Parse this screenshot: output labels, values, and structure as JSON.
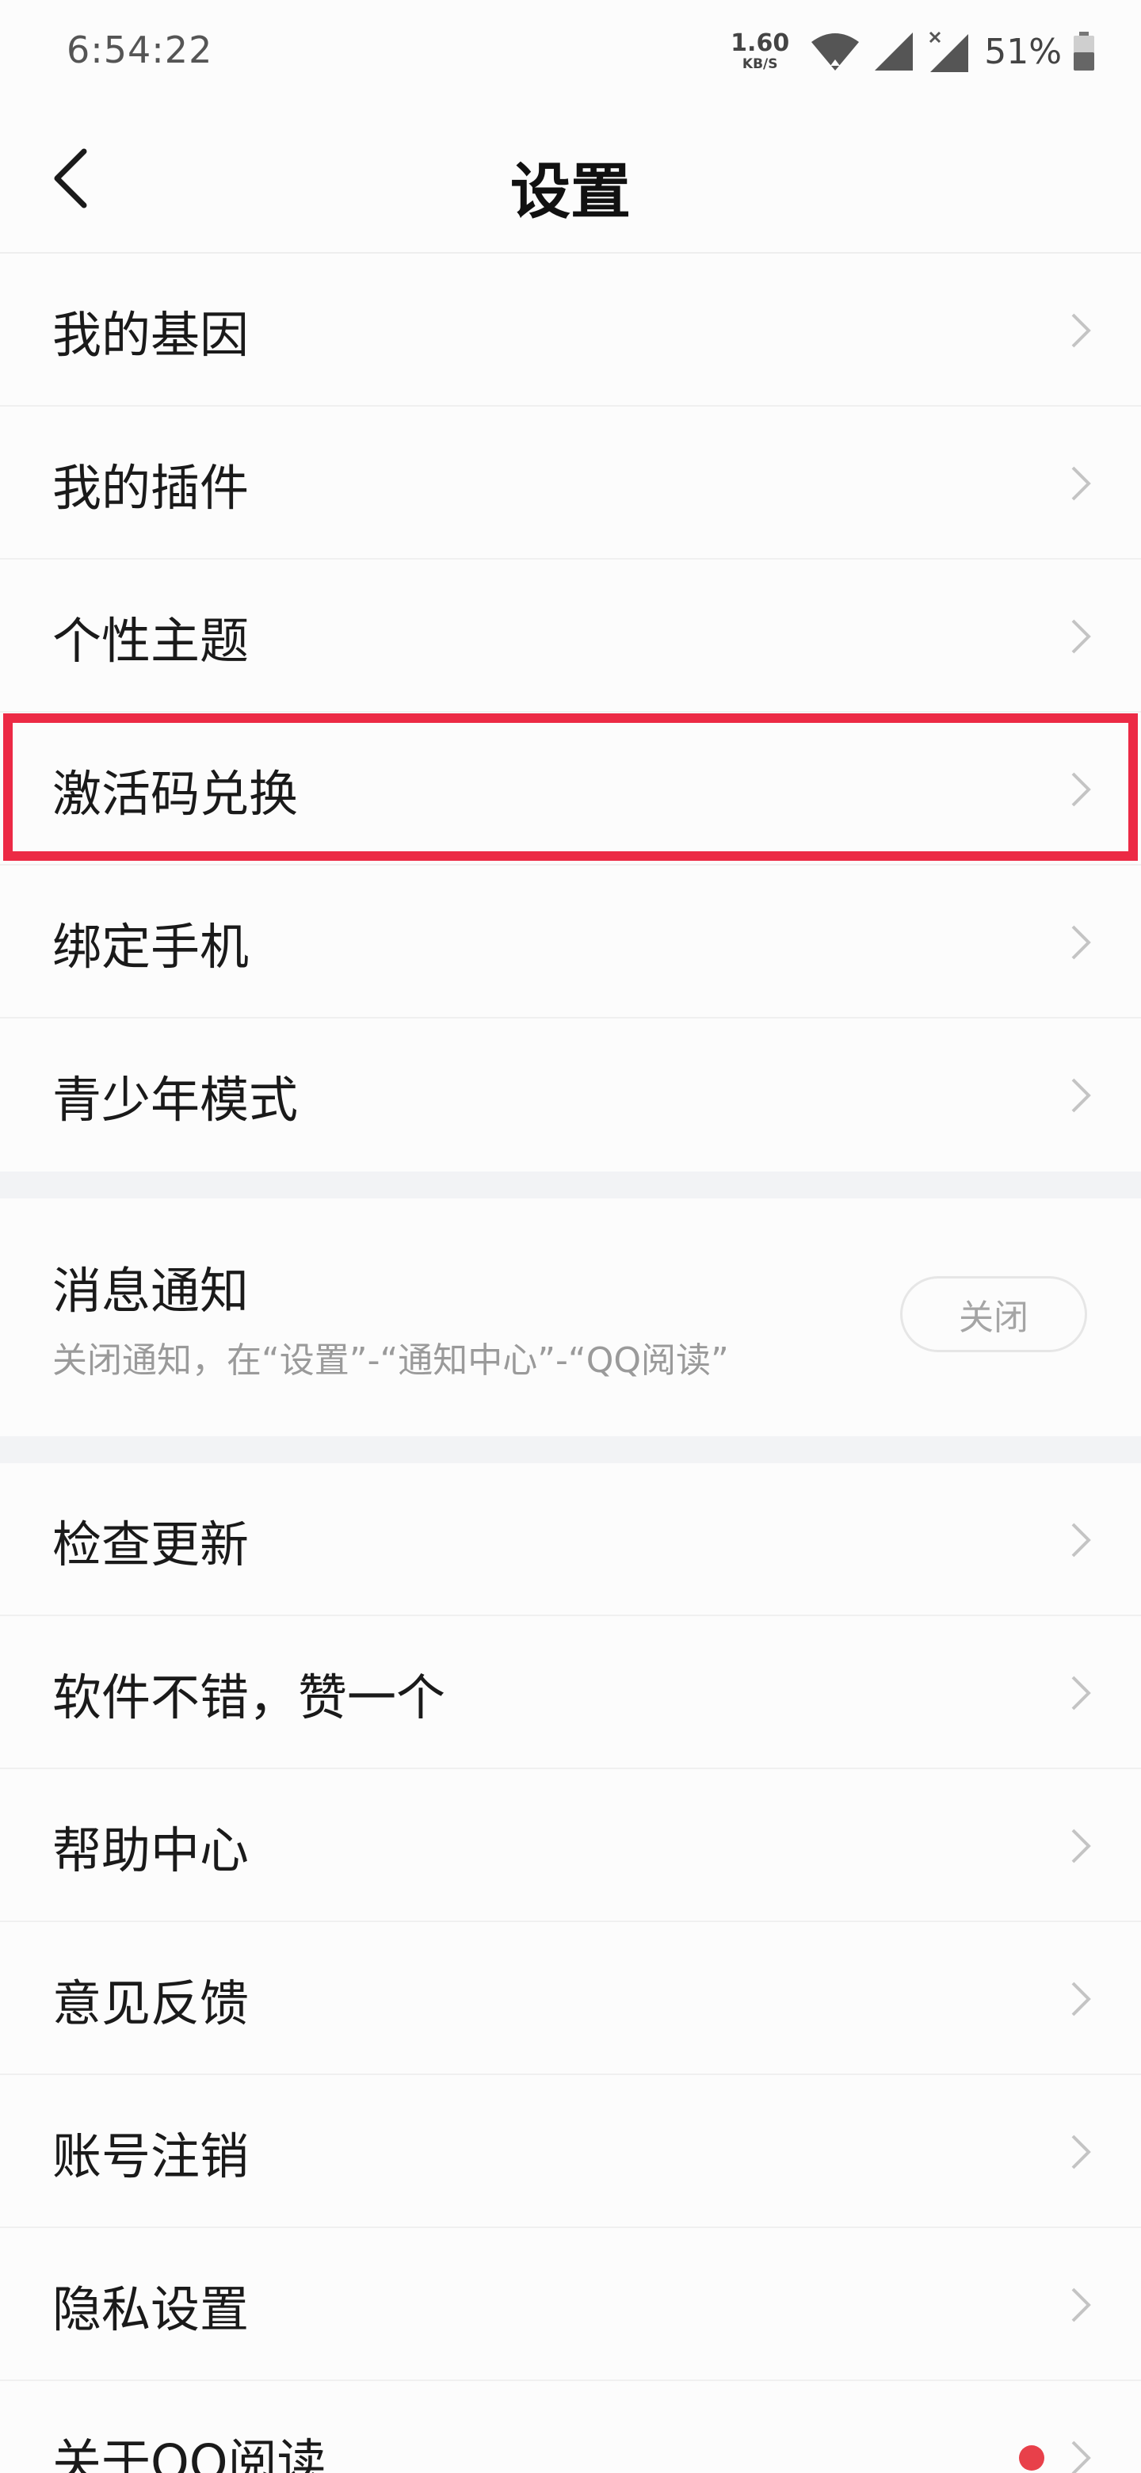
{
  "status_bar": {
    "time": "6:54:22",
    "net_speed_value": "1.60",
    "net_speed_unit": "KB/S",
    "battery_percent": "51%",
    "icons": [
      "wifi-icon",
      "signal-icon",
      "signal-x-icon",
      "battery-icon"
    ]
  },
  "header": {
    "title": "设置",
    "back_icon": "back-arrow-icon"
  },
  "group1": [
    {
      "label": "我的基因"
    },
    {
      "label": "我的插件"
    },
    {
      "label": "个性主题"
    },
    {
      "label": "激活码兑换"
    },
    {
      "label": "绑定手机"
    },
    {
      "label": "青少年模式"
    }
  ],
  "notification": {
    "title": "消息通知",
    "subtitle": "关闭通知，在“设置”-“通知中心”-“QQ阅读”",
    "toggle_label": "关闭"
  },
  "group2": [
    {
      "label": "检查更新"
    },
    {
      "label": "软件不错，赞一个"
    },
    {
      "label": "帮助中心"
    },
    {
      "label": "意见反馈"
    },
    {
      "label": "账号注销"
    },
    {
      "label": "隐私设置"
    },
    {
      "label": "关于QQ阅读"
    }
  ],
  "colors": {
    "highlight": "#ec2a45",
    "red_dot": "#e8404a",
    "separator": "#f2f3f5"
  }
}
